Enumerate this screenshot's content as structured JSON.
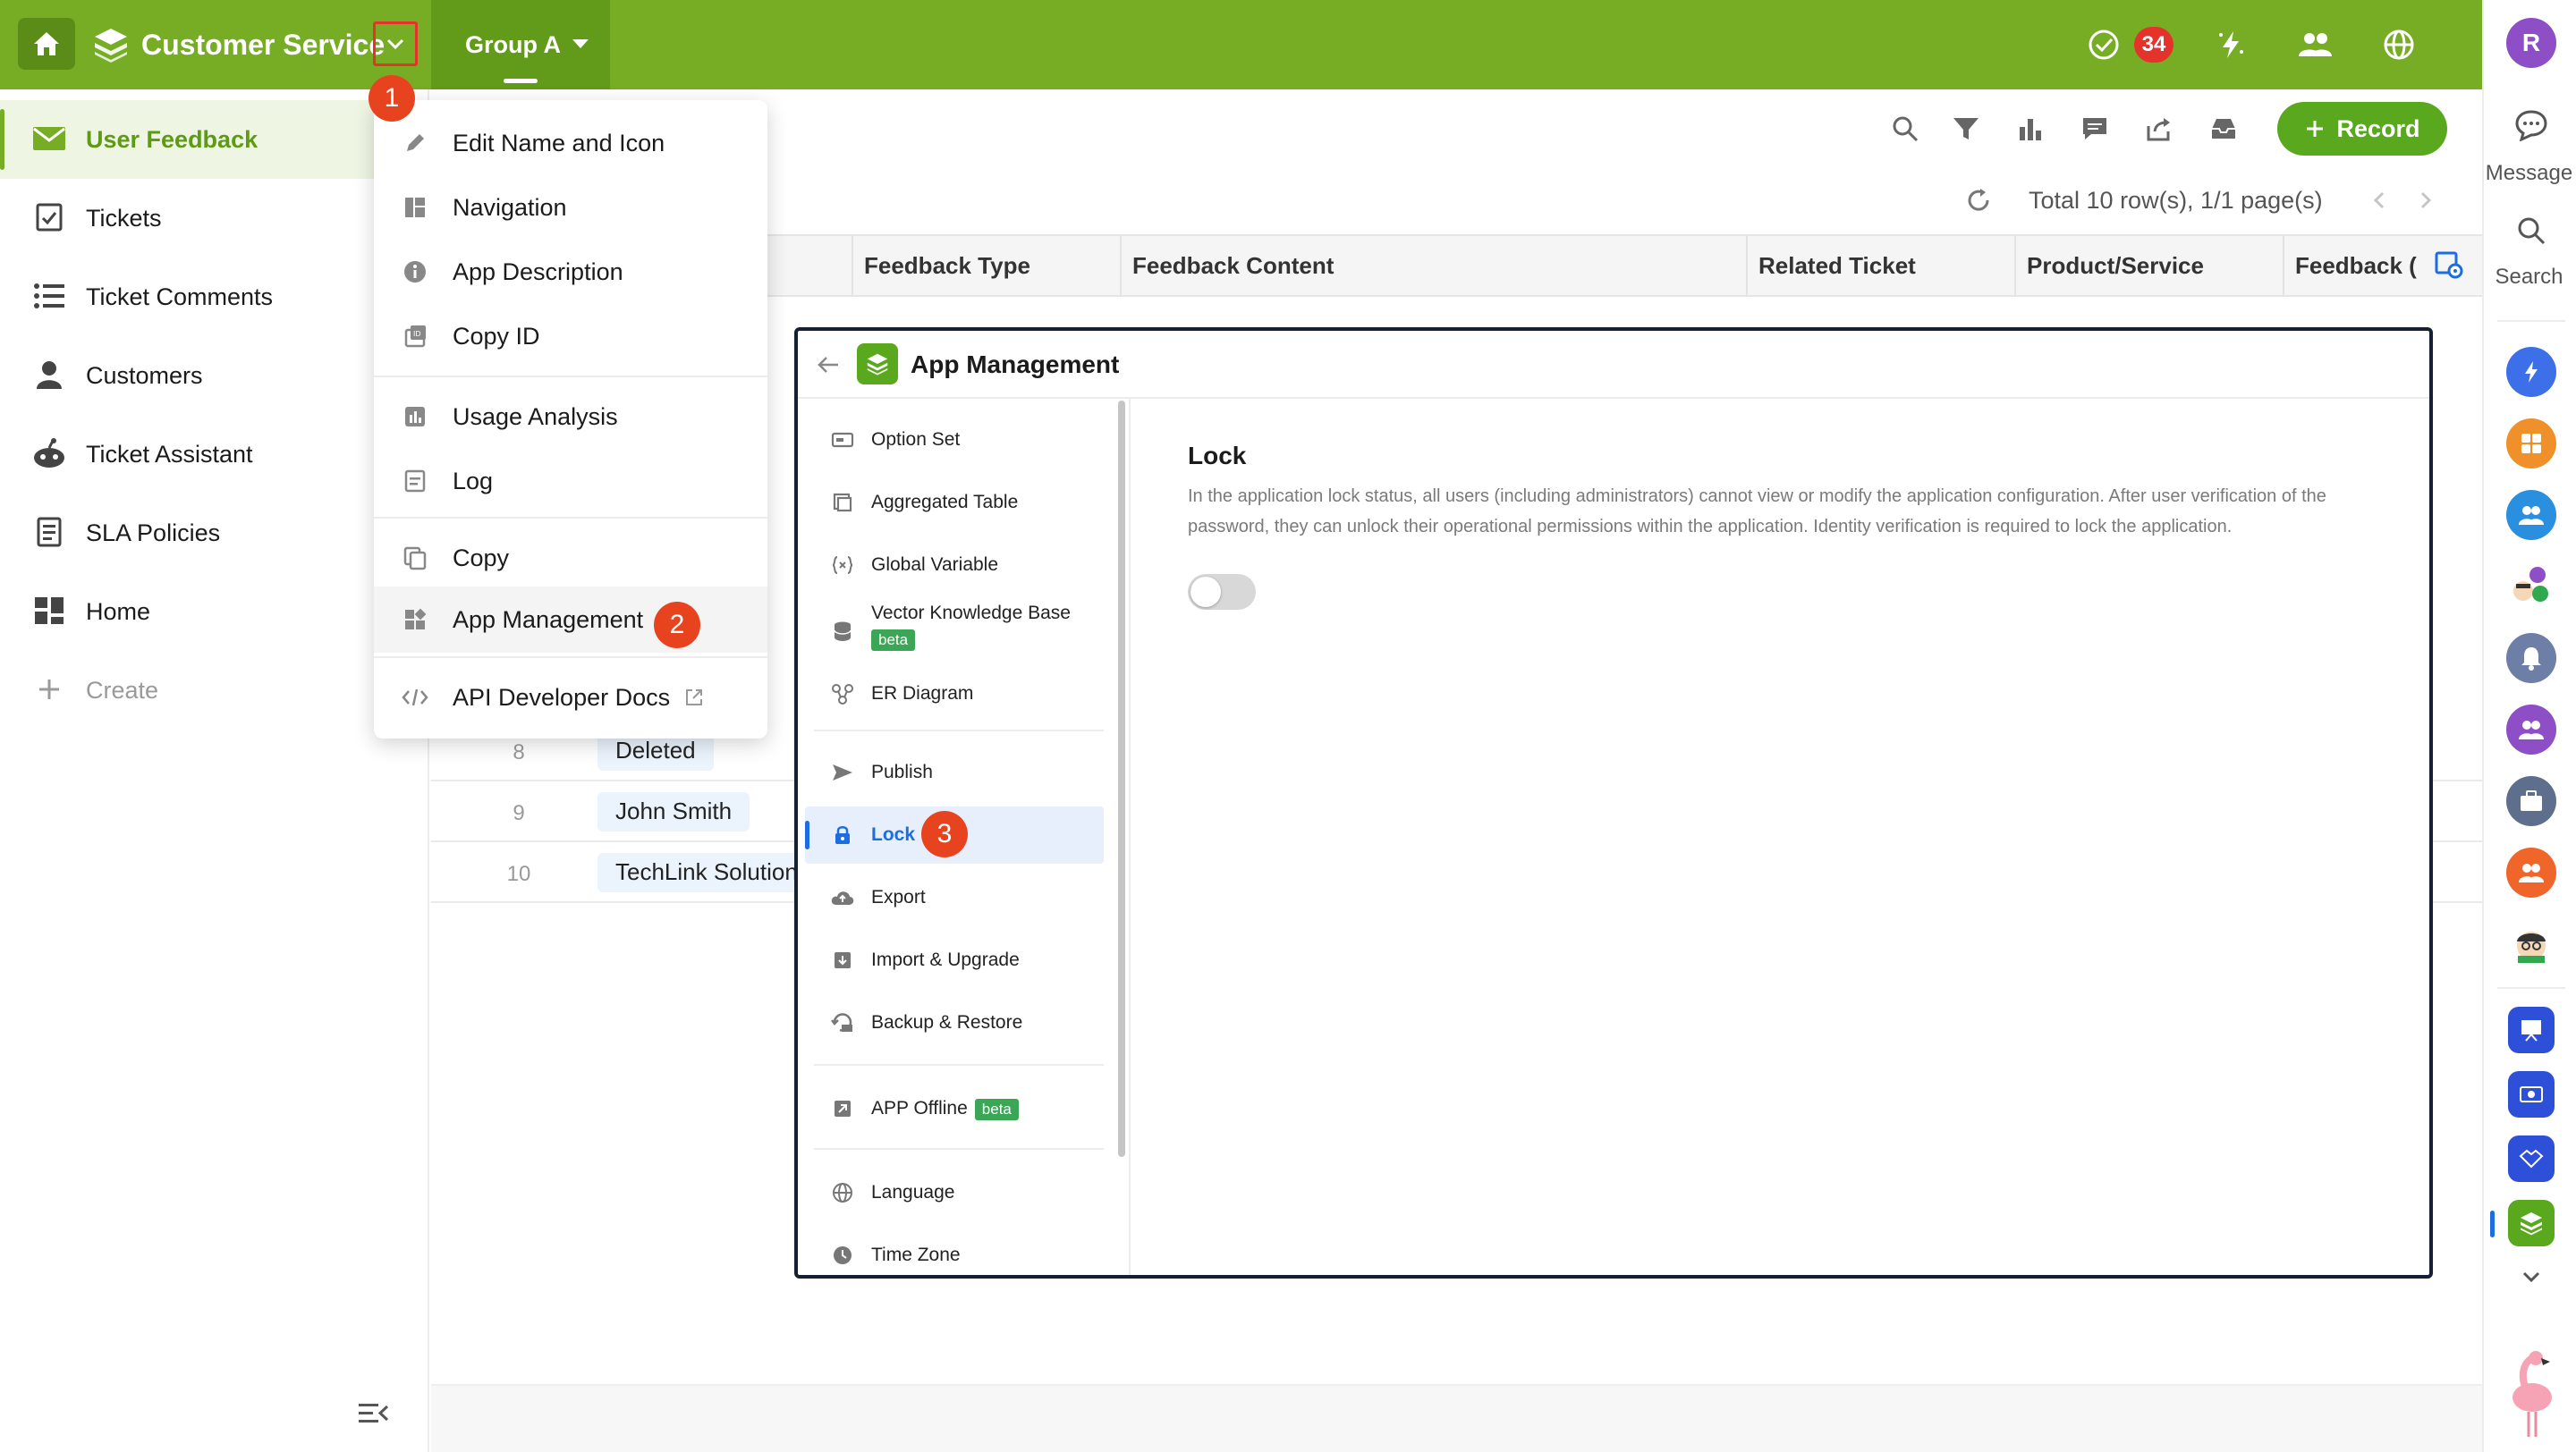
{
  "app": {
    "name": "Customer Service",
    "group": "Group A"
  },
  "topbar": {
    "badge_count": "34"
  },
  "sidebar": {
    "items": [
      {
        "label": "User Feedback",
        "icon": "mail-icon"
      },
      {
        "label": "Tickets",
        "icon": "checkbox-icon"
      },
      {
        "label": "Ticket Comments",
        "icon": "list-icon"
      },
      {
        "label": "Customers",
        "icon": "person-icon"
      },
      {
        "label": "Ticket Assistant",
        "icon": "robot-icon"
      },
      {
        "label": "SLA Policies",
        "icon": "document-icon"
      },
      {
        "label": "Home",
        "icon": "dashboard-icon"
      }
    ],
    "create_label": "Create"
  },
  "toolbar": {
    "record_label": "Record",
    "total_text": "Total 10 row(s), 1/1 page(s)"
  },
  "table": {
    "columns": [
      "Feedback Type",
      "Feedback Content",
      "Related Ticket",
      "Product/Service",
      "Feedback ("
    ],
    "rows": [
      {
        "num": "8",
        "name": "Deleted"
      },
      {
        "num": "9",
        "name": "John Smith"
      },
      {
        "num": "10",
        "name": "TechLink Solution"
      }
    ]
  },
  "dropdown": {
    "items": [
      {
        "label": "Edit Name and Icon"
      },
      {
        "label": "Navigation"
      },
      {
        "label": "App Description"
      },
      {
        "label": "Copy ID"
      },
      {
        "label": "Usage Analysis"
      },
      {
        "label": "Log"
      },
      {
        "label": "Copy"
      },
      {
        "label": "App Management"
      },
      {
        "label": "API Developer Docs"
      }
    ]
  },
  "steps": [
    "1",
    "2",
    "3"
  ],
  "modal": {
    "title": "App Management",
    "menu": [
      {
        "label": "Option Set"
      },
      {
        "label": "Aggregated Table"
      },
      {
        "label": "Global Variable"
      },
      {
        "label": "Vector Knowledge Base",
        "badge": "beta"
      },
      {
        "label": "ER Diagram"
      },
      {
        "label": "Publish"
      },
      {
        "label": "Lock"
      },
      {
        "label": "Export"
      },
      {
        "label": "Import & Upgrade"
      },
      {
        "label": "Backup & Restore"
      },
      {
        "label": "APP Offline",
        "badge": "beta"
      },
      {
        "label": "Language"
      },
      {
        "label": "Time Zone"
      }
    ],
    "lock": {
      "title": "Lock",
      "description": "In the application lock status, all users (including administrators) cannot view or modify the application configuration. After user verification of the password, they can unlock their operational permissions within the application. Identity verification is required to lock the application.",
      "enabled": false
    }
  },
  "rail": {
    "avatar_letter": "R",
    "message_label": "Message",
    "search_label": "Search"
  },
  "colors": {
    "brand_green": "#76ad24",
    "accent_blue": "#1c6de0",
    "step_red": "#e8431f"
  }
}
